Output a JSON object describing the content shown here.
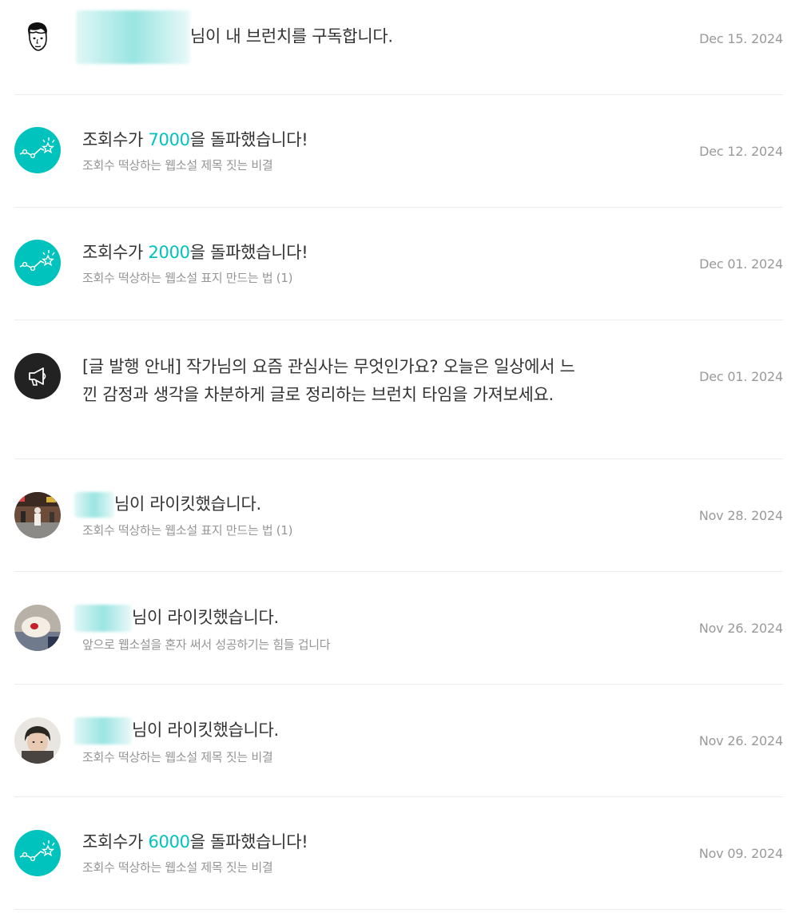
{
  "notifications": [
    {
      "kind": "subscribe",
      "icon": "user-avatar-icon",
      "pre": "",
      "highlight": "",
      "post": "님이 내 브런치를 구독합니다.",
      "sub": "",
      "date": "Dec 15. 2024"
    },
    {
      "kind": "milestone",
      "icon": "views-milestone-icon",
      "pre": "조회수가 ",
      "highlight": "7000",
      "post": "을 돌파했습니다!",
      "sub": "조회수 떡상하는 웹소설 제목 짓는 비결",
      "date": "Dec 12. 2024"
    },
    {
      "kind": "milestone",
      "icon": "views-milestone-icon",
      "pre": "조회수가 ",
      "highlight": "2000",
      "post": "을 돌파했습니다!",
      "sub": "조회수 떡상하는 웹소설 표지 만드는 법 (1)",
      "date": "Dec 01. 2024"
    },
    {
      "kind": "notice",
      "icon": "megaphone-icon",
      "pre": "[글 발행 안내] 작가님의 요즘 관심사는 무엇인가요? 오늘은 일상에서 느낀 감정과 생각을 차분하게 글로 정리하는 브런치 타임을 가져보세요.",
      "highlight": "",
      "post": "",
      "sub": "",
      "date": "Dec 01. 2024"
    },
    {
      "kind": "like",
      "icon": "user-avatar-icon",
      "pre": "",
      "highlight": "",
      "post": "님이 라이킷했습니다.",
      "sub": "조회수 떡상하는 웹소설 표지 만드는 법 (1)",
      "date": "Nov 28. 2024"
    },
    {
      "kind": "like",
      "icon": "user-avatar-icon",
      "pre": "",
      "highlight": "",
      "post": "님이 라이킷했습니다.",
      "sub": "앞으로 웹소설을 혼자 써서 성공하기는 힘들 겁니다",
      "date": "Nov 26. 2024"
    },
    {
      "kind": "like",
      "icon": "user-avatar-icon",
      "pre": "",
      "highlight": "",
      "post": "님이 라이킷했습니다.",
      "sub": "조회수 떡상하는 웹소설 제목 짓는 비결",
      "date": "Nov 26. 2024"
    },
    {
      "kind": "milestone",
      "icon": "views-milestone-icon",
      "pre": "조회수가 ",
      "highlight": "6000",
      "post": "을 돌파했습니다!",
      "sub": "조회수 떡상하는 웹소설 제목 짓는 비결",
      "date": "Nov 09. 2024"
    }
  ],
  "colors": {
    "accent": "#00c3bd",
    "notice_icon_bg": "#222222",
    "text": "#333333",
    "subtext": "#959595",
    "date": "#999999",
    "divider": "#ececec"
  }
}
